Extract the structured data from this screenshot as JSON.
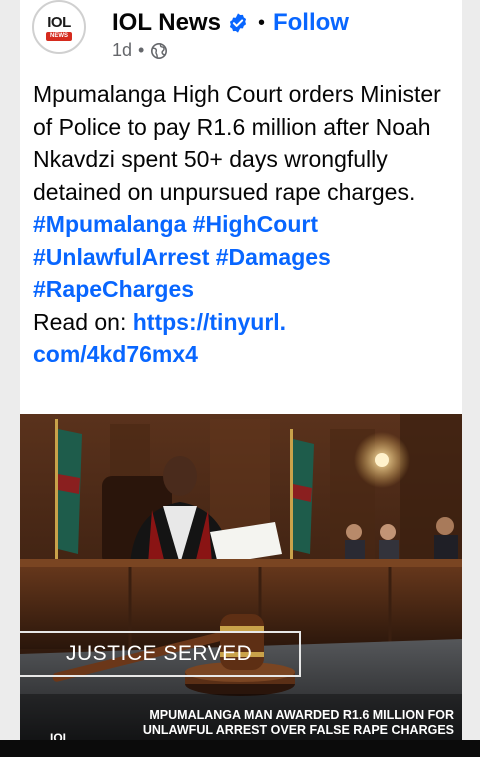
{
  "post": {
    "author": {
      "name": "IOL News",
      "logo_text": "IOL",
      "logo_tag": "NEWS",
      "verified": true
    },
    "follow_label": "Follow",
    "timestamp": "1d",
    "meta_separator": "•",
    "header_separator": "•",
    "audience_icon": "globe-icon",
    "text": "Mpumalanga High Court orders Minister of Police to pay R1.6 million after Noah Nkavdzi spent 50+ days wrongfully detained on unpursued rape charges.",
    "hashtags": [
      "#Mpumalanga",
      "#HighCourt",
      "#UnlawfulArrest",
      "#Damages",
      "#RapeCharges"
    ],
    "read_on_label": "Read on:",
    "link_text": "https://tinyurl.com/4kd76mx4",
    "image": {
      "label": "JUSTICE SERVED",
      "headline": "MPUMALANGA MAN AWARDED R1.6 MILLION FOR UNLAWFUL ARREST OVER FALSE RAPE CHARGES",
      "corner_logo": "IOL"
    }
  },
  "colors": {
    "link": "#0866ff",
    "verified_badge": "#0866ff",
    "logo_red": "#d52b1e"
  }
}
